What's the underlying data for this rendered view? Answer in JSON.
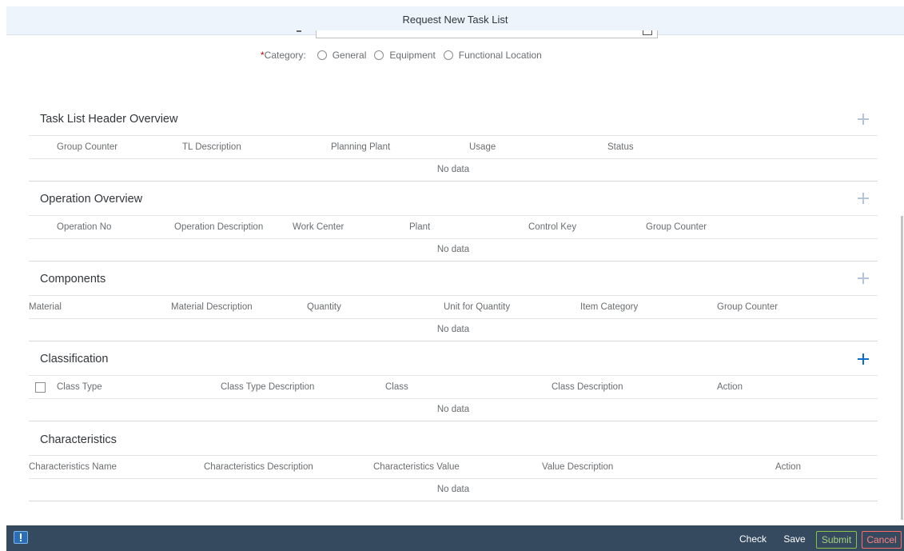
{
  "dialog": {
    "title": "Request New Task List"
  },
  "category": {
    "required_mark": "*",
    "label": "Category:",
    "options": [
      "General",
      "Equipment",
      "Functional Location"
    ]
  },
  "sections": {
    "header": {
      "title": "Task List Header Overview",
      "columns": [
        "Group Counter",
        "TL Description",
        "Planning Plant",
        "Usage",
        "Status"
      ],
      "empty_text": "No data"
    },
    "operation": {
      "title": "Operation Overview",
      "columns": [
        "Operation No",
        "Operation Description",
        "Work Center",
        "Plant",
        "Control Key",
        "Group Counter"
      ],
      "empty_text": "No data"
    },
    "components": {
      "title": "Components",
      "columns": [
        "Material",
        "Material Description",
        "Quantity",
        "Unit for Quantity",
        "Item Category",
        "Group Counter"
      ],
      "empty_text": "No data"
    },
    "classification": {
      "title": "Classification",
      "columns": [
        "Class Type",
        "Class Type Description",
        "Class",
        "Class Description",
        "Action"
      ],
      "empty_text": "No data"
    },
    "characteristics": {
      "title": "Characteristics",
      "columns": [
        "Characteristics Name",
        "Characteristics Description",
        "Characteristics Value",
        "Value Description",
        "Action"
      ],
      "empty_text": "No data"
    }
  },
  "footer": {
    "check": "Check",
    "save": "Save",
    "submit": "Submit",
    "cancel": "Cancel"
  },
  "icons": {
    "add": "add-icon",
    "message": "message-popover-icon",
    "calendar": "calendar-icon"
  },
  "colors": {
    "footer_bg": "#354a5f",
    "required": "#bb0000",
    "submit_border": "#8bc34a",
    "cancel_border": "#ff6b6b",
    "accent": "#0a6ed1"
  }
}
